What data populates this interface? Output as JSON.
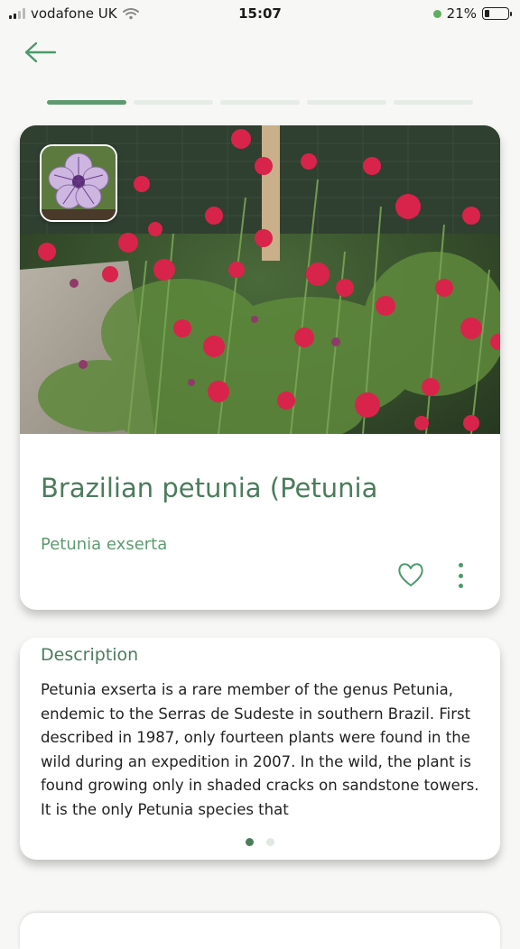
{
  "status_bar": {
    "carrier": "vodafone UK",
    "time": "15:07",
    "battery_percent": "21%",
    "battery_level": 0.21
  },
  "navigation": {
    "back_icon": "arrow-left-icon",
    "steps_total": 5,
    "step_active": 1
  },
  "plant": {
    "common_name": "Brazilian petunia (Petunia",
    "scientific_name": "Petunia exserta",
    "favorite_icon": "heart-icon",
    "more_icon": "more-vertical-icon"
  },
  "description": {
    "title": "Description",
    "text": "Petunia exserta is a rare member of the genus Petunia, endemic to the Serras de Sudeste in southern Brazil. First described in 1987, only fourteen plants were found in the wild during an expedition in 2007. In the wild, the plant is found growing only in shaded cracks on sandstone towers. It is the only Petunia species that",
    "pages_total": 2,
    "page_active": 1
  },
  "colors": {
    "accent": "#4b7c5c",
    "accent_light": "#5e9a70",
    "background": "#f7f7f5"
  }
}
